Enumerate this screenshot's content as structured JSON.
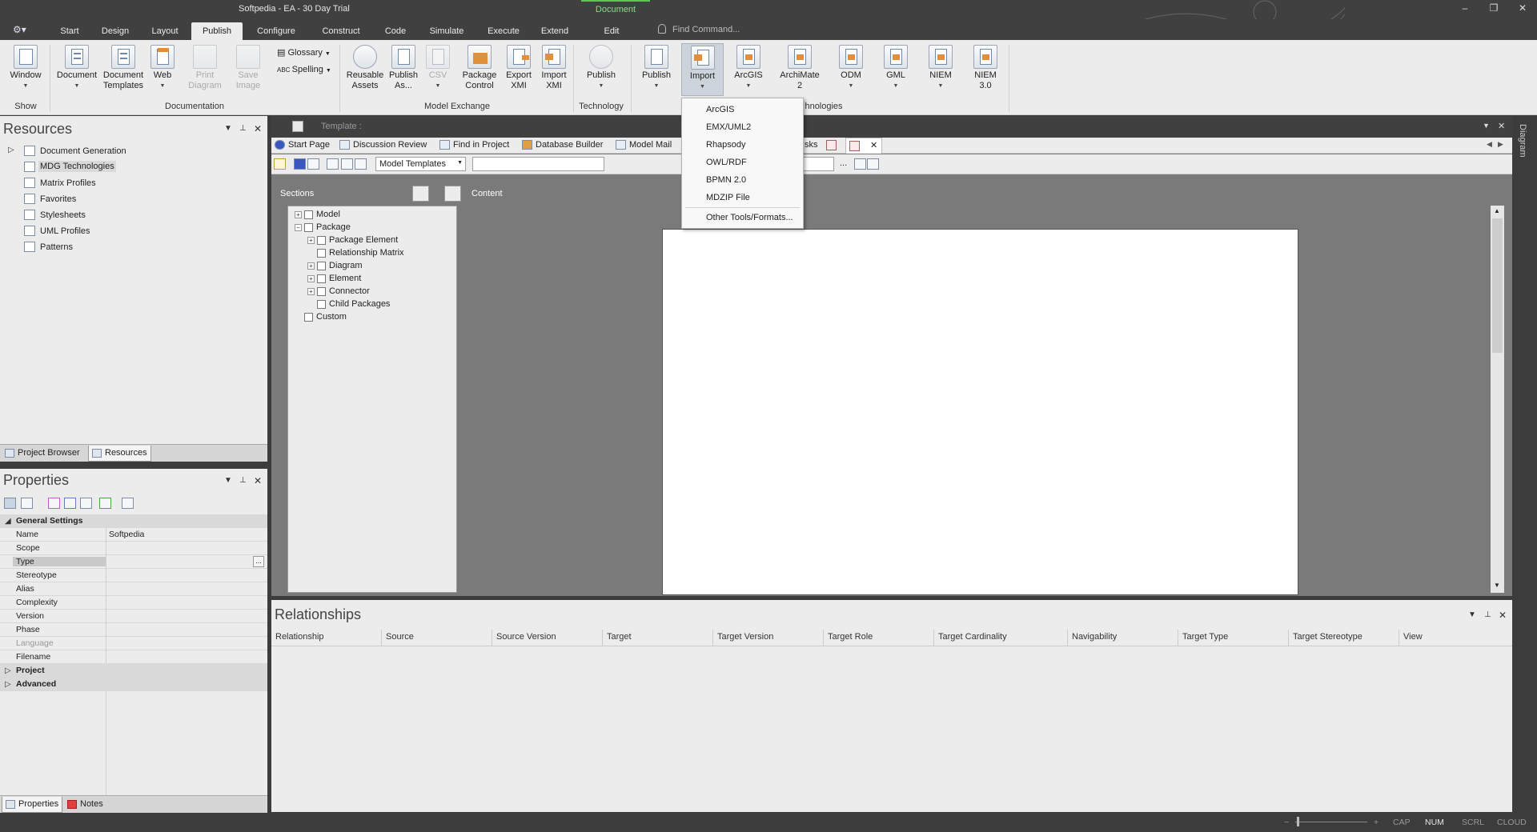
{
  "window": {
    "title": "Softpedia - EA - 30 Day Trial",
    "context_tab": "Document",
    "minimize": "–",
    "restore": "❐",
    "close": "✕"
  },
  "menu": {
    "tabs": [
      "Start",
      "Design",
      "Layout",
      "Publish",
      "Configure",
      "Construct",
      "Code",
      "Simulate",
      "Execute",
      "Extend",
      "Edit"
    ],
    "active_tab": "Publish",
    "find_placeholder": "Find Command..."
  },
  "ribbon": {
    "window_btn": "Window",
    "show_label": "Show",
    "document_btn": "Document",
    "document_templates_btn": [
      "Document",
      "Templates"
    ],
    "web_btn": "Web",
    "print_diagram_btn": [
      "Print",
      "Diagram"
    ],
    "save_image_btn": [
      "Save",
      "Image"
    ],
    "glossary_btn": "Glossary",
    "spelling_btn": "Spelling",
    "documentation_label": "Documentation",
    "reusable_assets_btn": [
      "Reusable",
      "Assets"
    ],
    "publish_as_btn": [
      "Publish",
      "As..."
    ],
    "csv_btn": "CSV",
    "package_control_btn": [
      "Package",
      "Control"
    ],
    "export_xmi_btn": [
      "Export",
      "XMI"
    ],
    "import_xmi_btn": [
      "Import",
      "XMI"
    ],
    "model_exchange_label": "Model Exchange",
    "publish_tech_btn": "Publish",
    "technology_label": "Technology",
    "publish_btn": "Publish",
    "import_btn": "Import",
    "arcgis_btn": "ArcGIS",
    "archimate_btn": [
      "ArchiMate",
      "2"
    ],
    "odm_btn": "ODM",
    "gml_btn": "GML",
    "niem_btn": "NIEM",
    "niem3_btn": [
      "NIEM",
      "3.0"
    ],
    "technologies_label": "hnologies"
  },
  "import_menu": {
    "items": [
      "ArcGIS",
      "EMX/UML2",
      "Rhapsody",
      "OWL/RDF",
      "BPMN 2.0",
      "MDZIP File"
    ],
    "other": "Other Tools/Formats..."
  },
  "resources": {
    "title": "Resources",
    "items": [
      "Document Generation",
      "MDG Technologies",
      "Matrix Profiles",
      "Favorites",
      "Stylesheets",
      "UML Profiles",
      "Patterns"
    ],
    "selected": "MDG Technologies",
    "tabs": [
      "Project Browser",
      "Resources"
    ]
  },
  "properties": {
    "title": "Properties",
    "general_settings": "General Settings",
    "rows": [
      {
        "key": "Name",
        "value": "Softpedia"
      },
      {
        "key": "Scope",
        "value": ""
      },
      {
        "key": "Type",
        "value": ""
      },
      {
        "key": "Stereotype",
        "value": ""
      },
      {
        "key": "Alias",
        "value": ""
      },
      {
        "key": "Complexity",
        "value": ""
      },
      {
        "key": "Version",
        "value": ""
      },
      {
        "key": "Phase",
        "value": ""
      },
      {
        "key": "Language",
        "value": ""
      },
      {
        "key": "Filename",
        "value": ""
      }
    ],
    "project": "Project",
    "advanced": "Advanced",
    "ellipsis": "...",
    "tabs": [
      "Properties",
      "Notes"
    ]
  },
  "document": {
    "template_label": "Template :",
    "tabs": [
      "Start Page",
      "Discussion Review",
      "Find in Project",
      "Database Builder",
      "Model Mail",
      "sks"
    ],
    "combo_value": "Model Templates",
    "more": "...",
    "sections_label": "Sections",
    "content_label": "Content",
    "sections": [
      {
        "label": "Model",
        "level": 0,
        "expander": "+"
      },
      {
        "label": "Package",
        "level": 0,
        "expander": "−"
      },
      {
        "label": "Package Element",
        "level": 1,
        "expander": "+"
      },
      {
        "label": "Relationship Matrix",
        "level": 1,
        "expander": ""
      },
      {
        "label": "Diagram",
        "level": 1,
        "expander": "+"
      },
      {
        "label": "Element",
        "level": 1,
        "expander": "+"
      },
      {
        "label": "Connector",
        "level": 1,
        "expander": "+"
      },
      {
        "label": "Child Packages",
        "level": 1,
        "expander": ""
      },
      {
        "label": "Custom",
        "level": 0,
        "expander": ""
      }
    ]
  },
  "relationships": {
    "title": "Relationships",
    "columns": [
      "Relationship",
      "Source",
      "Source Version",
      "Target",
      "Target Version",
      "Target Role",
      "Target Cardinality",
      "Navigability",
      "Target Type",
      "Target Stereotype",
      "View"
    ]
  },
  "right_dock": {
    "label": "Diagram"
  },
  "status": {
    "minus": "−",
    "plus": "+",
    "cap": "CAP",
    "num": "NUM",
    "scrl": "SCRL",
    "cloud": "CLOUD"
  },
  "colors": {
    "accent_green": "#57c857",
    "chrome_dark": "#404040",
    "panel": "#ececec"
  }
}
